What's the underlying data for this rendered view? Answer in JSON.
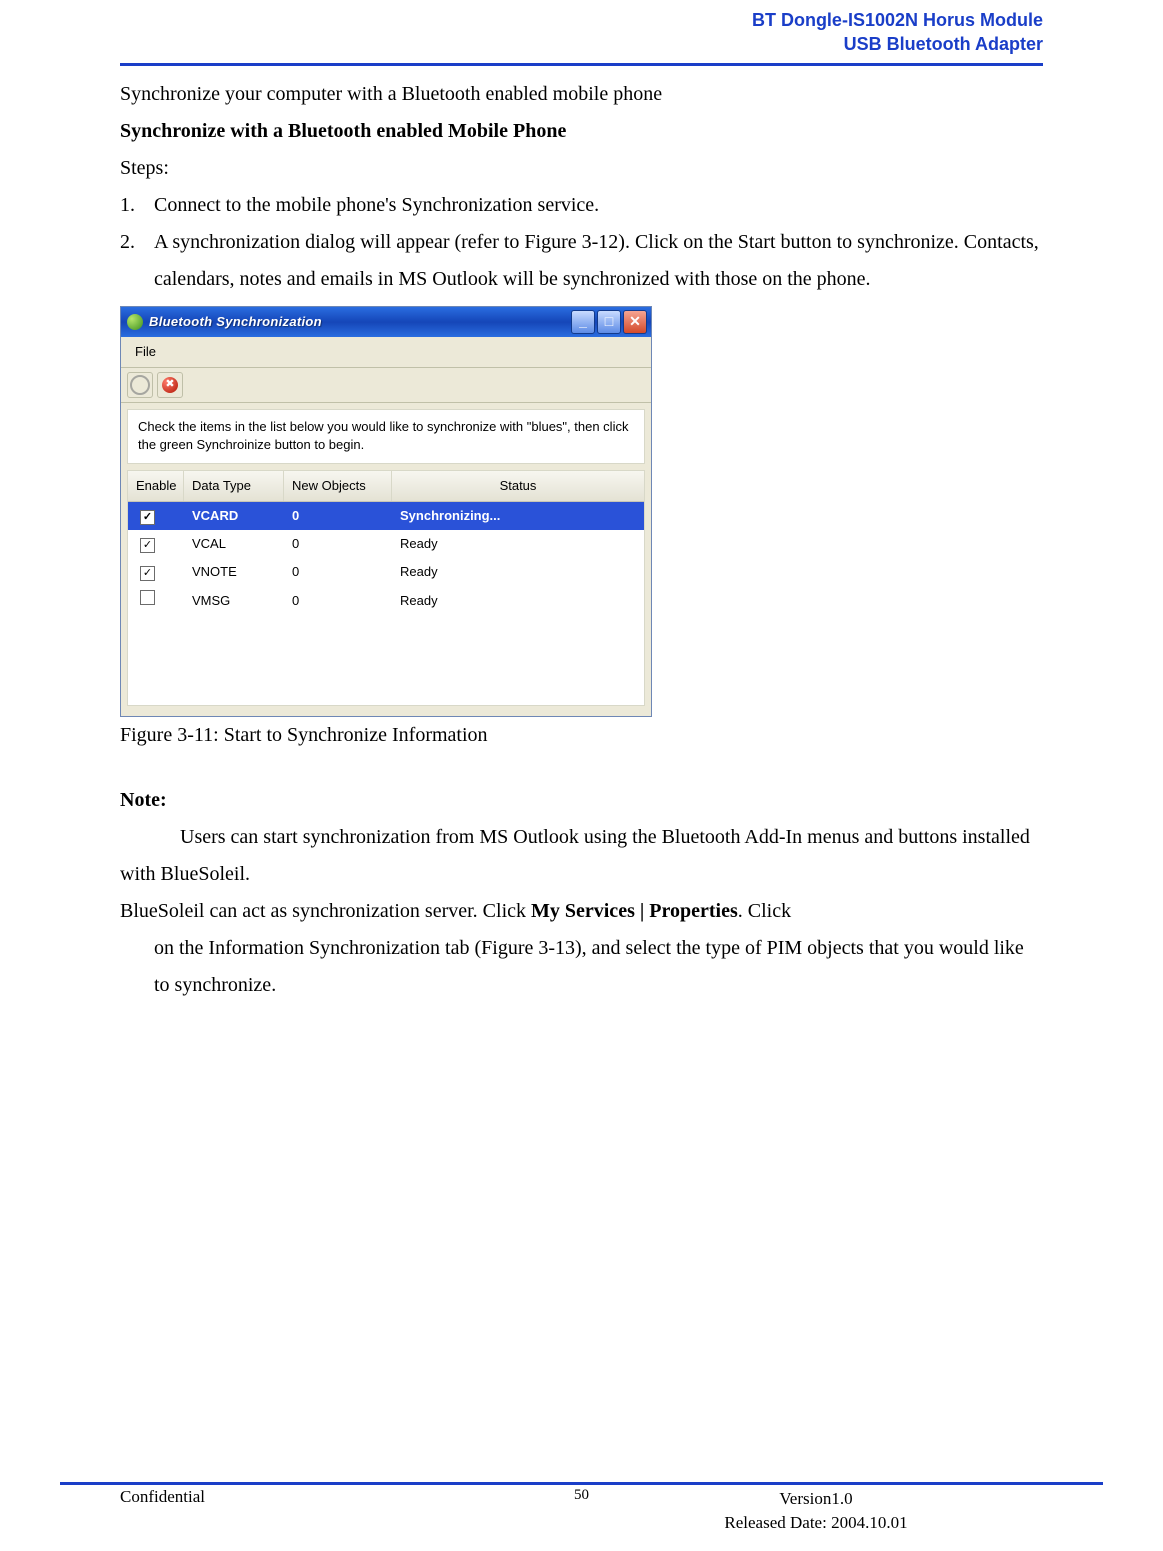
{
  "header": {
    "line1": "BT Dongle-IS1002N Horus Module",
    "line2": "USB Bluetooth Adapter"
  },
  "body": {
    "intro": "Synchronize your computer with a Bluetooth enabled mobile phone",
    "subtitle": "Synchronize with a Bluetooth enabled Mobile Phone",
    "steps_label": "Steps:",
    "step1_num": "1.",
    "step1_text": "Connect to the mobile phone's Synchronization service.",
    "step2_num": "2.",
    "step2_text": "A synchronization dialog will appear (refer to Figure 3-12). Click on the Start button to synchronize. Contacts, calendars, notes and emails in MS Outlook will be synchronized with those on the phone.",
    "fig_caption": "Figure 3-11: Start to Synchronize Information",
    "note_label": "Note:",
    "note_text": "Users can start synchronization from MS Outlook using the Bluetooth Add-In menus and buttons installed with BlueSoleil.",
    "server_lead": "BlueSoleil can act as synchronization server. Click ",
    "server_bold": "My Services | Properties",
    "server_tail": ". Click",
    "server_rest": "on the Information Synchronization tab (Figure 3-13), and select the type of PIM objects that you would like to synchronize."
  },
  "window": {
    "title": "Bluetooth Synchronization",
    "menu_file": "File",
    "stop_glyph": "✖",
    "instructions": "Check the items in the list below you would like to synchronize with \"blues\", then click the green Synchroinize button to begin.",
    "headers": {
      "enable": "Enable",
      "data_type": "Data Type",
      "new_objects": "New Objects",
      "status": "Status"
    },
    "rows": [
      {
        "enabled": "✓",
        "type": "VCARD",
        "new": "0",
        "status": "Synchronizing...",
        "selected": true
      },
      {
        "enabled": "✓",
        "type": "VCAL",
        "new": "0",
        "status": "Ready",
        "selected": false
      },
      {
        "enabled": "✓",
        "type": "VNOTE",
        "new": "0",
        "status": "Ready",
        "selected": false
      },
      {
        "enabled": "",
        "type": "VMSG",
        "new": "0",
        "status": "Ready",
        "selected": false
      }
    ]
  },
  "footer": {
    "confidential": "Confidential",
    "page": "50",
    "version": "Version1.0",
    "released": "Released Date: 2004.10.01"
  }
}
